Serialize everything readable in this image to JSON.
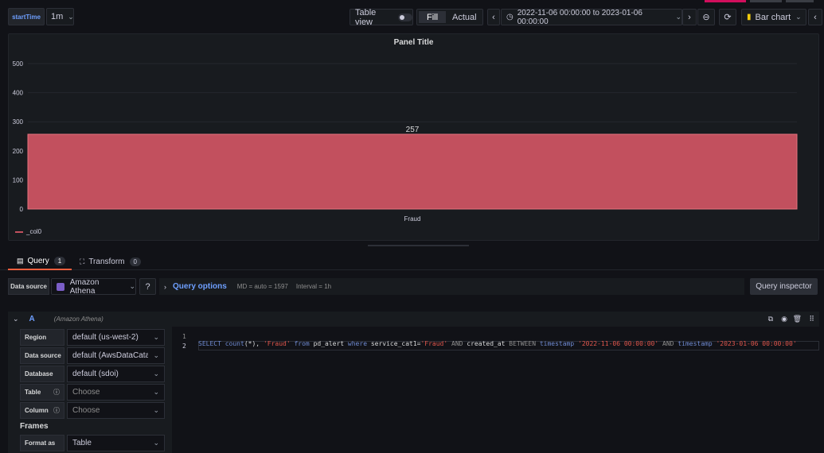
{
  "toolbar": {
    "variable_label": "startTime",
    "variable_value": "1m",
    "table_view_label": "Table view",
    "fill_label": "Fill",
    "actual_label": "Actual",
    "time_range": "2022-11-06 00:00:00 to 2023-01-06 00:00:00",
    "viz_label": "Bar chart"
  },
  "panel": {
    "title": "Panel Title",
    "legend_label": "_col0",
    "bar_color": "#c2505e"
  },
  "chart_data": {
    "type": "bar",
    "categories": [
      "Fraud"
    ],
    "series": [
      {
        "name": "_col0",
        "values": [
          257
        ]
      }
    ],
    "yticks": [
      "500",
      "400",
      "300",
      "200",
      "100",
      "0"
    ],
    "ylim": [
      0,
      500
    ],
    "data_labels": [
      "257"
    ],
    "legend": "bottom-left"
  },
  "tabs": [
    {
      "label": "Query",
      "count": "1"
    },
    {
      "label": "Transform",
      "count": "0"
    }
  ],
  "query_bar": {
    "data_source_label": "Data source",
    "data_source_value": "Amazon Athena",
    "query_options_label": "Query options",
    "md_info": "MD = auto = 1597",
    "interval_info": "Interval = 1h",
    "inspector_label": "Query inspector"
  },
  "query_row": {
    "ref_id": "A",
    "ds_name": "(Amazon Athena)"
  },
  "form": {
    "region_label": "Region",
    "region_value": "default (us-west-2)",
    "datasource_label": "Data source",
    "datasource_value": "default (AwsDataCata...",
    "database_label": "Database",
    "database_value": "default (sdoi)",
    "table_label": "Table",
    "table_placeholder": "Choose",
    "column_label": "Column",
    "column_placeholder": "Choose",
    "frames_label": "Frames",
    "format_label": "Format as",
    "format_value": "Table"
  },
  "editor": {
    "line1": "1",
    "line2": "2",
    "t_select": "SELECT",
    "t_count": "count",
    "t_star": "(*),",
    "t_fraud": "'Fraud'",
    "t_from": "from",
    "t_table": "pd_alert",
    "t_where": "where",
    "t_col": "service_cat1=",
    "t_fraud2": "'Fraud'",
    "t_and1": "AND",
    "t_created": "created_at",
    "t_between": "BETWEEN",
    "t_ts1": "timestamp",
    "t_d1": "'2022-11-06 00:00:00'",
    "t_and2": "AND",
    "t_ts2": "timestamp",
    "t_d2": "'2023-01-06 00:00:00'"
  }
}
